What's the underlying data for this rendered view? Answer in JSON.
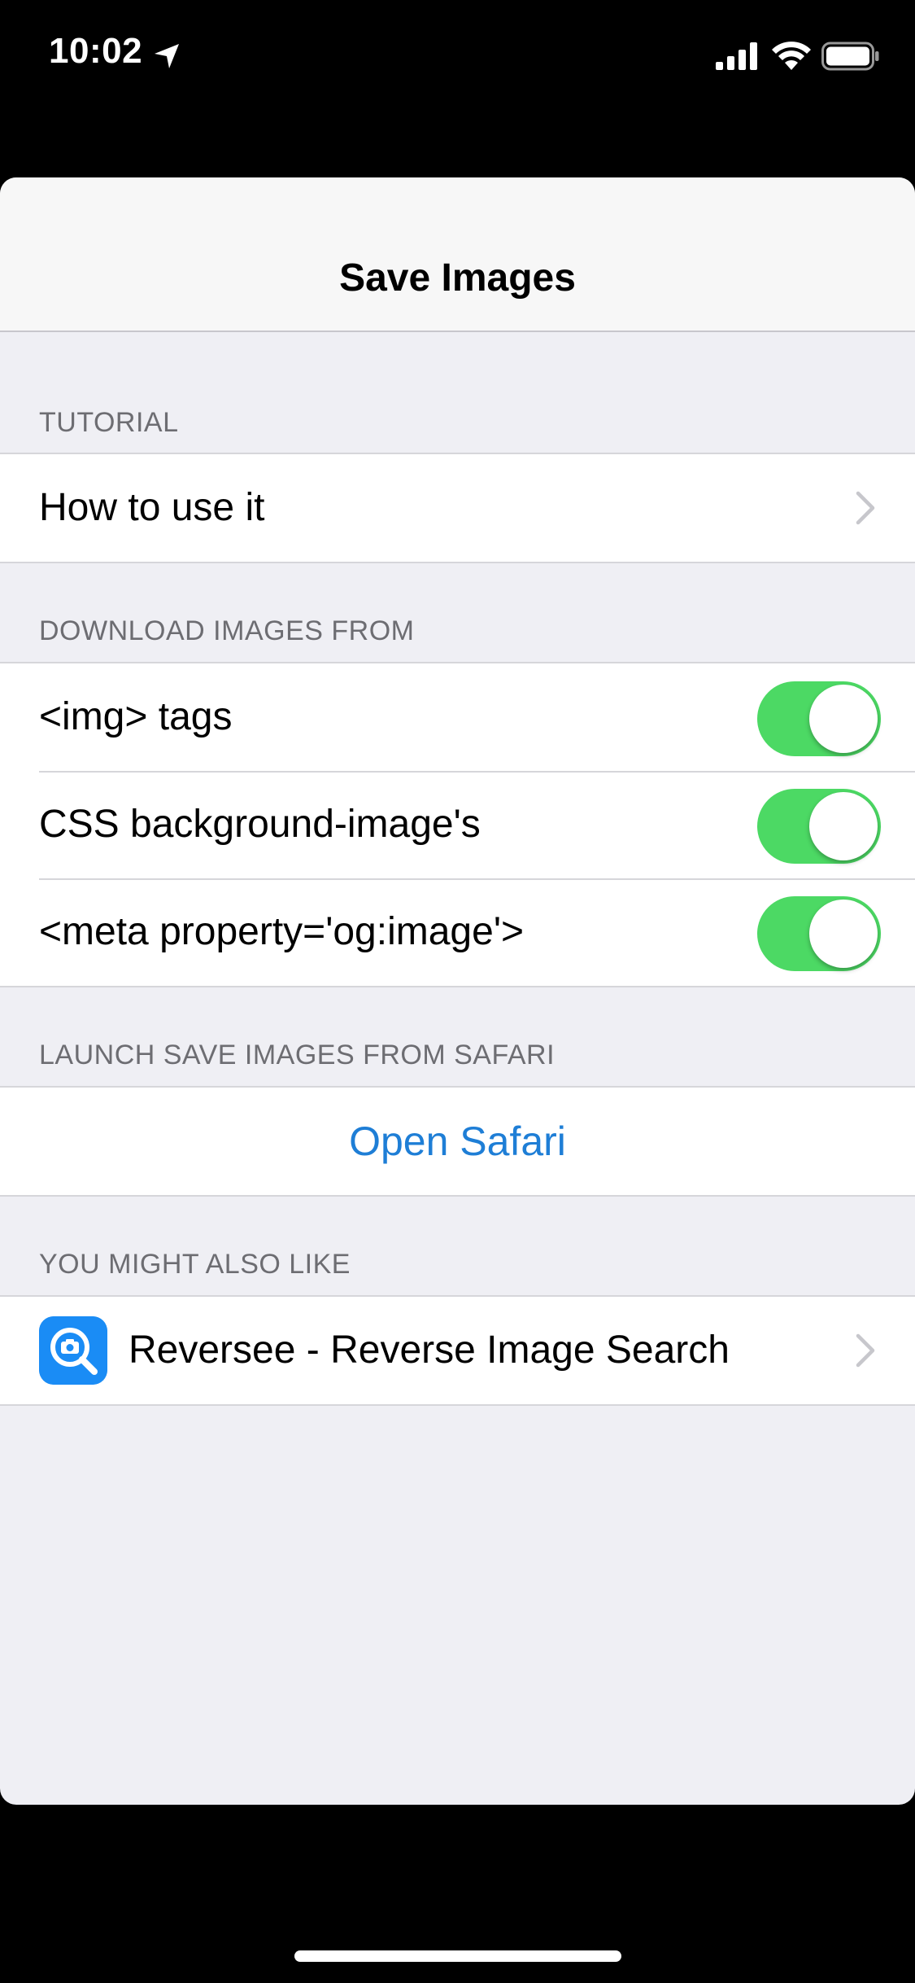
{
  "status_bar": {
    "time": "10:02",
    "icons": [
      "location-arrow-icon",
      "cellular-signal-icon",
      "wifi-icon",
      "battery-icon"
    ]
  },
  "nav": {
    "title": "Save Images"
  },
  "sections": {
    "tutorial": {
      "header": "TUTORIAL",
      "rows": [
        {
          "label": "How to use it"
        }
      ]
    },
    "download": {
      "header": "DOWNLOAD IMAGES FROM",
      "rows": [
        {
          "label": "<img> tags",
          "enabled": true
        },
        {
          "label": "CSS background-image's",
          "enabled": true
        },
        {
          "label": "<meta property='og:image'>",
          "enabled": true
        }
      ]
    },
    "launch": {
      "header": "LAUNCH SAVE IMAGES FROM SAFARI",
      "action_label": "Open Safari"
    },
    "recommend": {
      "header": "YOU MIGHT ALSO LIKE",
      "rows": [
        {
          "label": "Reversee - Reverse Image Search",
          "icon": "reversee-app-icon"
        }
      ]
    }
  },
  "colors": {
    "toggle_on": "#4cd964",
    "link": "#1e7ed6",
    "app_icon": "#1a8cf5",
    "group_background": "#efeff4"
  }
}
